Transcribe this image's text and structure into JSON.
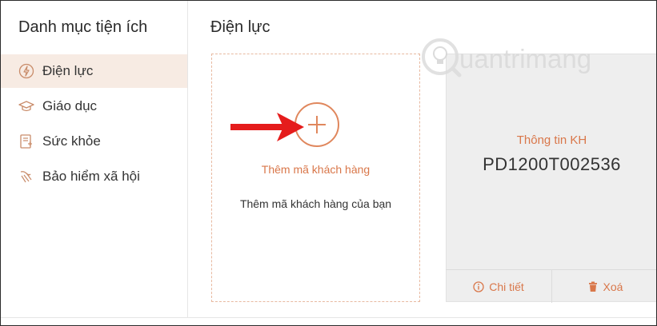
{
  "sidebar": {
    "title": "Danh mục tiện ích",
    "items": [
      {
        "label": "Điện lực",
        "icon": "electricity-icon",
        "active": true
      },
      {
        "label": "Giáo dục",
        "icon": "graduation-cap-icon",
        "active": false
      },
      {
        "label": "Sức khỏe",
        "icon": "health-document-icon",
        "active": false
      },
      {
        "label": "Bảo hiểm xã hội",
        "icon": "social-insurance-icon",
        "active": false
      }
    ]
  },
  "main": {
    "title": "Điện lực",
    "add_card": {
      "title": "Thêm mã khách hàng",
      "description": "Thêm mã khách hàng của bạn"
    },
    "customer_card": {
      "label": "Thông tin KH",
      "code": "PD1200T002536",
      "detail_label": "Chi tiết",
      "delete_label": "Xoá"
    }
  },
  "watermark": {
    "text": "uantrimang"
  },
  "colors": {
    "accent": "#d9774a",
    "active_bg": "#f7ebe3",
    "arrow": "#e51c1c",
    "card_bg": "#eeeeee"
  }
}
